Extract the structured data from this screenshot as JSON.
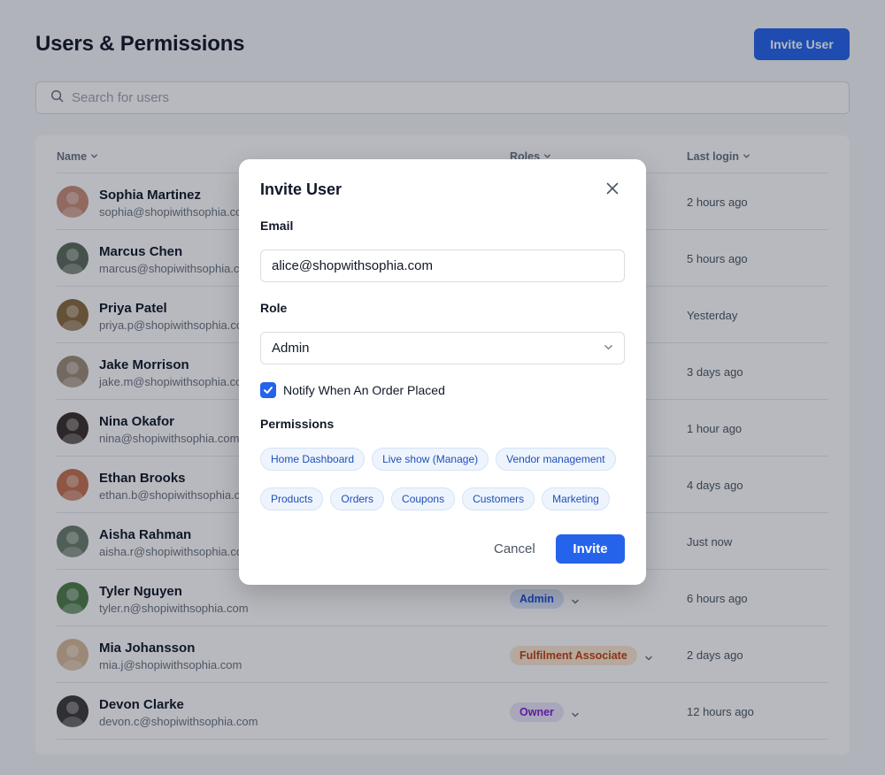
{
  "page": {
    "title": "Users & Permissions",
    "invite_button": "Invite User"
  },
  "search": {
    "placeholder": "Search for users",
    "value": ""
  },
  "table": {
    "columns": [
      "Name",
      "Roles",
      "Last login"
    ],
    "rows": [
      {
        "name": "Sophia Martinez",
        "email": "sophia@shopiwithsophia.com",
        "role": "",
        "last_login": "2 hours ago"
      },
      {
        "name": "Marcus Chen",
        "email": "marcus@shopiwithsophia.com",
        "role": "",
        "last_login": "5 hours ago"
      },
      {
        "name": "Priya Patel",
        "email": "priya.p@shopiwithsophia.com",
        "role": "",
        "last_login": "Yesterday"
      },
      {
        "name": "Jake Morrison",
        "email": "jake.m@shopiwithsophia.com",
        "role": "",
        "last_login": "3 days ago"
      },
      {
        "name": "Nina Okafor",
        "email": "nina@shopiwithsophia.com",
        "role": "",
        "last_login": "1 hour ago"
      },
      {
        "name": "Ethan Brooks",
        "email": "ethan.b@shopiwithsophia.com",
        "role": "",
        "last_login": "4 days ago"
      },
      {
        "name": "Aisha Rahman",
        "email": "aisha.r@shopiwithsophia.com",
        "role": "",
        "last_login": "Just now"
      },
      {
        "name": "Tyler Nguyen",
        "email": "tyler.n@shopiwithsophia.com",
        "role": "Admin",
        "last_login": "6 hours ago"
      },
      {
        "name": "Mia Johansson",
        "email": "mia.j@shopiwithsophia.com",
        "role": "Fulfilment Associate",
        "last_login": "2 days ago"
      },
      {
        "name": "Devon Clarke",
        "email": "devon.c@shopiwithsophia.com",
        "role": "Owner",
        "last_login": "12 hours ago"
      }
    ]
  },
  "role_colors": {
    "Admin": {
      "bg": "#dbe6fb",
      "fg": "#1d4ed8"
    },
    "Fulfilment Associate": {
      "bg": "#fde7d3",
      "fg": "#c2410c"
    },
    "Owner": {
      "bg": "#ede4fb",
      "fg": "#7e22ce"
    }
  },
  "avatar_colors": [
    "#c98d7a",
    "#5c6b5a",
    "#8a6a3f",
    "#a08d78",
    "#3a2f2a",
    "#c4724f",
    "#6b7d6a",
    "#4f7d4a",
    "#d8b99a",
    "#3e3a38"
  ],
  "modal": {
    "title": "Invite User",
    "email_label": "Email",
    "email_value": "alice@shopwithsophia.com",
    "role_label": "Role",
    "role_value": "Admin",
    "notify_label": "Notify When An Order Placed",
    "notify_checked": true,
    "permissions_label": "Permissions",
    "permissions_row1": [
      "Home Dashboard",
      "Live show (Manage)",
      "Vendor management"
    ],
    "permissions_row2": [
      "Products",
      "Orders",
      "Coupons",
      "Customers",
      "Marketing"
    ],
    "cancel_label": "Cancel",
    "invite_label": "Invite"
  },
  "colors": {
    "accent": "#2563eb"
  }
}
